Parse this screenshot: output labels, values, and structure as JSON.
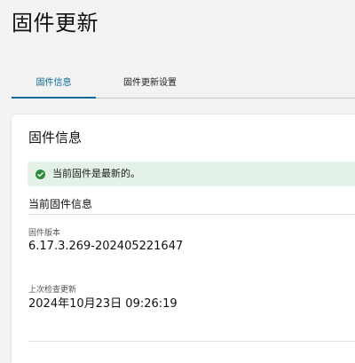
{
  "header": {
    "title": "固件更新"
  },
  "tabs": [
    {
      "label": "固件信息",
      "active": true
    },
    {
      "label": "固件更新设置",
      "active": false
    }
  ],
  "card": {
    "title": "固件信息",
    "status": {
      "icon": "check-circle-icon",
      "text": "当前固件是最新的。",
      "color": "#2e8b3e",
      "background": "#e4f1e6"
    },
    "section_title": "当前固件信息",
    "fields": {
      "version_label": "固件版本",
      "version_value": "6.17.3.269-202405221647",
      "last_check_label": "上次检查更新",
      "last_check_value": "2024年10月23日 09:26:19"
    }
  },
  "colors": {
    "accent": "#0b6a9b",
    "page_background": "#f3f3f3",
    "card_background": "#ffffff"
  }
}
